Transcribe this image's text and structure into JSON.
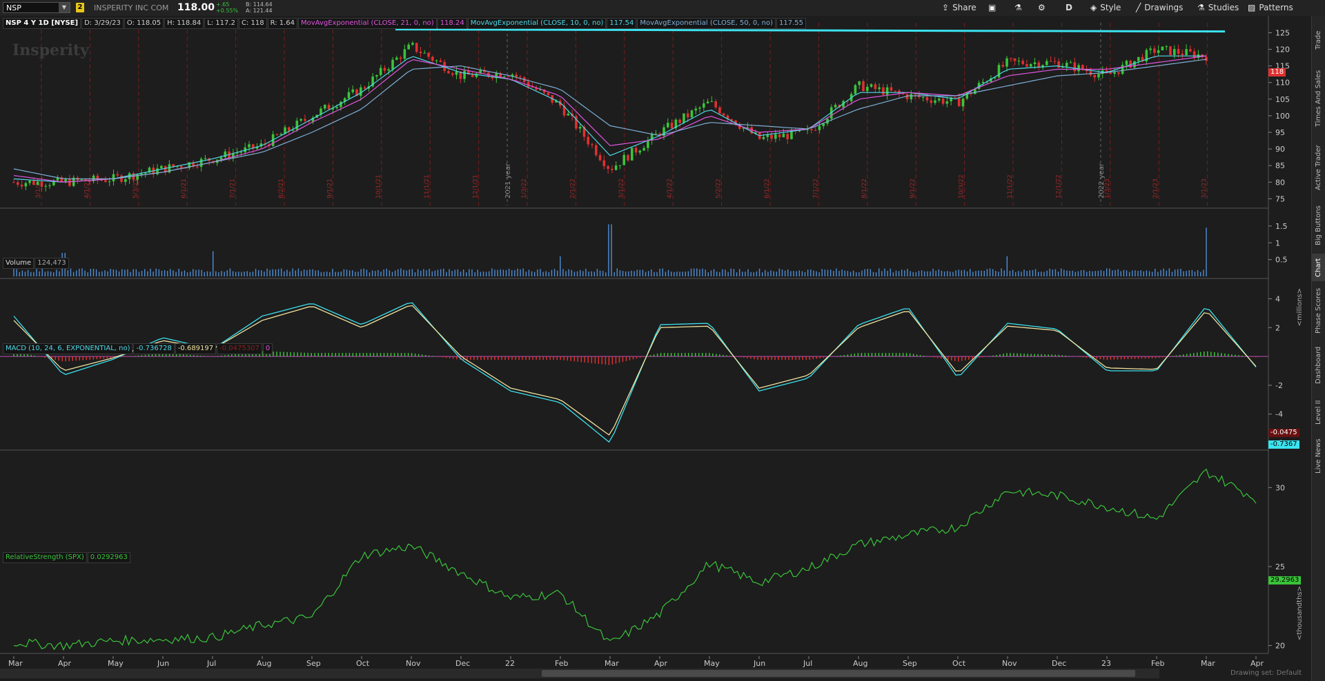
{
  "header": {
    "symbol": "NSP",
    "link_badge": "2",
    "company": "INSPERITY INC COM",
    "last": "118.00",
    "change": "+.65",
    "change_pct": "+0.55%",
    "bid": "B: 114.64",
    "ask": "A: 121.44"
  },
  "toolbar": {
    "share": "Share",
    "period": "D",
    "style": "Style",
    "drawings": "Drawings",
    "studies": "Studies",
    "patterns": "Patterns"
  },
  "sidebar": {
    "tabs": [
      "Trade",
      "Times And Sales",
      "Active Trader",
      "Big Buttons",
      "Chart",
      "Phase Scores",
      "Dashboard",
      "Level II",
      "Live News"
    ],
    "active": "Chart"
  },
  "price_panel": {
    "title": "NSP 4 Y 1D [NYSE]",
    "date": "D: 3/29/23",
    "open": "O: 118.05",
    "high": "H: 118.84",
    "low": "L: 117.2",
    "close": "C: 118",
    "range": "R: 1.64",
    "ema21_label": "MovAvgExponential (CLOSE, 21, 0, no)",
    "ema21_value": "118.24",
    "ema10_label": "MovAvgExponential (CLOSE, 10, 0, no)",
    "ema10_value": "117.54",
    "ema50_label": "MovAvgExponential (CLOSE, 50, 0, no)",
    "ema50_value": "117.55",
    "watermark": "Insperity",
    "last_tag": "118",
    "year_marks": [
      "2021 year",
      "2022 year"
    ],
    "date_marks": [
      "3/1/21",
      "4/1/21",
      "5/3/21",
      "6/1/21",
      "7/1/21",
      "8/2/21",
      "9/1/21",
      "10/1/21",
      "11/1/21",
      "12/1/21",
      "1/3/22",
      "2/1/22",
      "3/1/22",
      "4/1/22",
      "5/2/22",
      "6/1/22",
      "7/1/22",
      "8/1/22",
      "9/1/22",
      "10/3/22",
      "11/1/22",
      "12/1/22",
      "1/3/23",
      "2/1/23",
      "3/1/23"
    ]
  },
  "volume_panel": {
    "label": "Volume",
    "value": "124,473",
    "unit": "<millions>"
  },
  "macd_panel": {
    "label": "MACD (10, 24, 6, EXPONENTIAL, no)",
    "value": "-0.736728",
    "avg": "-0.689197",
    "diff": "-0.0475307",
    "zero": "0",
    "diff_tag": "-0.0475",
    "value_tag": "-0.7367"
  },
  "rs_panel": {
    "label": "RelativeStrength (SPX)",
    "value": "0.0292963",
    "tag": "29.2963",
    "unit": "<thousandths>"
  },
  "scrollbar": {
    "drawing_set": "Drawing set: Default"
  },
  "colors": {
    "ema10": "#4fd8e8",
    "ema21": "#e055e0",
    "ema50": "#7fb0d8",
    "up": "#3ac43a",
    "down": "#e03030",
    "resistance": "#3be3f0",
    "macd": "#3be3f0",
    "signal": "#f0e4a0",
    "rs": "#3ac43a"
  },
  "chart_data": [
    {
      "type": "candlestick",
      "title": "NSP 4 Y 1D [NYSE]",
      "x": [
        "Mar",
        "Apr",
        "May",
        "Jun",
        "Jul",
        "Aug",
        "Sep",
        "Oct",
        "Nov",
        "Dec",
        "22",
        "Feb",
        "Mar",
        "Apr",
        "May",
        "Jun",
        "Jul",
        "Aug",
        "Sep",
        "Oct",
        "Nov",
        "Dec",
        "23",
        "Feb",
        "Mar",
        "Apr"
      ],
      "series": [
        {
          "name": "Close",
          "values": [
            80,
            80,
            81,
            84,
            87,
            91,
            100,
            108,
            121,
            112,
            113,
            103,
            84,
            95,
            104,
            93,
            95,
            109,
            106,
            104,
            116,
            116,
            112,
            120,
            118,
            null
          ]
        },
        {
          "name": "MovAvgExponential (CLOSE, 10, 0, no)",
          "values": [
            81,
            80,
            81,
            84,
            87,
            91,
            99,
            107,
            118,
            113,
            111,
            104,
            88,
            94,
            102,
            94,
            96,
            107,
            107,
            105,
            114,
            115,
            113,
            118,
            118,
            null
          ]
        },
        {
          "name": "MovAvgExponential (CLOSE, 21, 0, no)",
          "values": [
            82,
            80,
            81,
            83,
            86,
            90,
            98,
            105,
            117,
            114,
            111,
            106,
            91,
            93,
            100,
            95,
            96,
            105,
            107,
            106,
            112,
            114,
            114,
            116,
            118,
            null
          ]
        },
        {
          "name": "MovAvgExponential (CLOSE, 50, 0, no)",
          "values": [
            84,
            81,
            81,
            83,
            86,
            89,
            95,
            102,
            114,
            115,
            112,
            108,
            97,
            94,
            98,
            97,
            96,
            102,
            106,
            106,
            109,
            112,
            113,
            115,
            117,
            null
          ]
        }
      ],
      "resistance_line": 126,
      "ylim": [
        73,
        128
      ],
      "yticks": [
        75,
        80,
        85,
        90,
        95,
        100,
        105,
        110,
        115,
        120,
        125
      ]
    },
    {
      "type": "bar",
      "title": "Volume",
      "x": [
        "Mar",
        "Apr",
        "May",
        "Jun",
        "Jul",
        "Aug",
        "Sep",
        "Oct",
        "Nov",
        "Dec",
        "22",
        "Feb",
        "Mar",
        "Apr",
        "May",
        "Jun",
        "Jul",
        "Aug",
        "Sep",
        "Oct",
        "Nov",
        "Dec",
        "23",
        "Feb",
        "Mar",
        "Apr"
      ],
      "values": [
        0.15,
        0.7,
        0.15,
        0.15,
        0.75,
        0.15,
        0.15,
        0.15,
        0.2,
        0.2,
        0.2,
        0.6,
        1.55,
        0.2,
        0.15,
        0.2,
        0.15,
        0.15,
        0.15,
        0.2,
        0.6,
        0.2,
        0.15,
        0.2,
        1.45,
        null
      ],
      "ylabel": "<millions>",
      "ylim": [
        0,
        1.6
      ],
      "yticks": [
        0.5,
        1,
        1.5
      ]
    },
    {
      "type": "line",
      "title": "MACD (10, 24, 6, EXPONENTIAL, no)",
      "x": [
        "Mar",
        "Apr",
        "May",
        "Jun",
        "Jul",
        "Aug",
        "Sep",
        "Oct",
        "Nov",
        "Dec",
        "22",
        "Feb",
        "Mar",
        "Apr",
        "May",
        "Jun",
        "Jul",
        "Aug",
        "Sep",
        "Oct",
        "Nov",
        "Dec",
        "23",
        "Feb",
        "Mar",
        "Apr"
      ],
      "series": [
        {
          "name": "Value",
          "values": [
            2.8,
            -1.3,
            -0.2,
            1.3,
            0.5,
            2.8,
            3.7,
            2.2,
            3.8,
            -0.2,
            -2.4,
            -3.2,
            -6.0,
            2.2,
            2.3,
            -2.4,
            -1.5,
            2.2,
            3.4,
            -1.5,
            2.3,
            1.9,
            -1.0,
            -1.0,
            3.5,
            -0.74
          ]
        },
        {
          "name": "Avg",
          "values": [
            2.5,
            -1.0,
            -0.1,
            1.1,
            0.5,
            2.5,
            3.5,
            2.0,
            3.6,
            0.0,
            -2.2,
            -3.0,
            -5.5,
            2.0,
            2.1,
            -2.2,
            -1.3,
            2.0,
            3.2,
            -1.2,
            2.1,
            1.8,
            -0.8,
            -0.9,
            3.2,
            -0.69
          ]
        },
        {
          "name": "Diff",
          "values": [
            0.3,
            -0.3,
            -0.1,
            0.2,
            0.0,
            0.3,
            0.2,
            0.2,
            0.2,
            -0.2,
            -0.2,
            -0.2,
            -0.5,
            0.2,
            0.2,
            -0.2,
            -0.2,
            0.2,
            0.2,
            -0.3,
            0.2,
            0.1,
            -0.2,
            -0.1,
            0.3,
            -0.05
          ]
        }
      ],
      "ylim": [
        -6.5,
        4.5
      ],
      "yticks": [
        -6,
        -4,
        -2,
        2,
        4
      ]
    },
    {
      "type": "line",
      "title": "RelativeStrength (SPX)",
      "x": [
        "Mar",
        "Apr",
        "May",
        "Jun",
        "Jul",
        "Aug",
        "Sep",
        "Oct",
        "Nov",
        "Dec",
        "22",
        "Feb",
        "Mar",
        "Apr",
        "May",
        "Jun",
        "Jul",
        "Aug",
        "Sep",
        "Oct",
        "Nov",
        "Dec",
        "23",
        "Feb",
        "Mar",
        "Apr"
      ],
      "values": [
        20.2,
        20.0,
        20.3,
        20.4,
        20.5,
        21.3,
        21.8,
        25.7,
        26.3,
        24.6,
        23.0,
        23.3,
        20.1,
        22.0,
        25.2,
        24.0,
        24.9,
        26.4,
        27.0,
        27.5,
        29.8,
        29.5,
        28.8,
        28.0,
        31.0,
        29.3
      ],
      "ylabel": "<thousandths>",
      "ylim": [
        19.5,
        31.5
      ],
      "yticks": [
        20,
        25,
        30
      ]
    }
  ]
}
